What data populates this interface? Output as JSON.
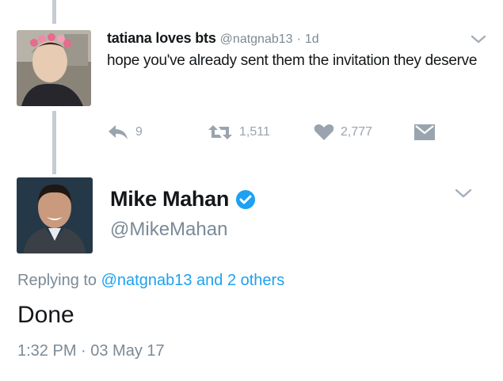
{
  "reply_tweet": {
    "author_name": "tatiana loves bts",
    "handle": "@natgnab13",
    "separator": "·",
    "time": "1d",
    "text": "hope you've already sent them the invitation they deserve",
    "reply_count": "9",
    "retweet_count": "1,511",
    "like_count": "2,777"
  },
  "main_tweet": {
    "author_name": "Mike Mahan",
    "verified": true,
    "handle": "@MikeMahan",
    "replying_prefix": "Replying to",
    "replying_targets": "@natgnab13 and 2 others",
    "text": "Done",
    "timestamp": "1:32 PM · 03 May 17"
  },
  "colors": {
    "link_blue": "#1da1f2",
    "muted_gray": "#7b8a96",
    "action_gray": "#99a4ae",
    "thread_line": "#c4ccd3"
  },
  "icons": [
    "reply-icon",
    "retweet-icon",
    "heart-icon",
    "direct-message-icon",
    "chevron-down-icon",
    "verified-badge-icon"
  ]
}
